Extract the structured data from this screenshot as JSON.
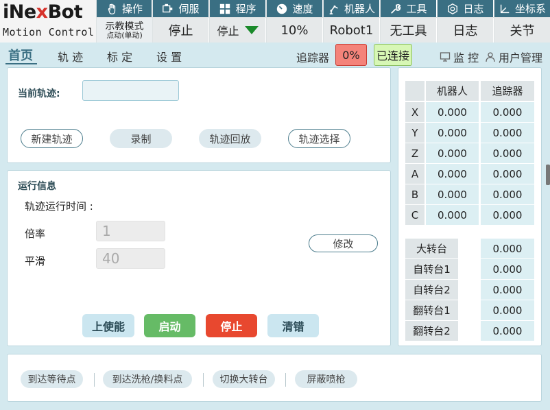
{
  "logo": {
    "brand_prefix": "iNe",
    "brand_x": "x",
    "brand_suffix": "Bot",
    "subtitle": "Motion Control"
  },
  "menu": [
    {
      "label": "操作",
      "icon": "hand-icon"
    },
    {
      "label": "伺服",
      "icon": "servo-icon"
    },
    {
      "label": "程序",
      "icon": "program-grid-icon"
    },
    {
      "label": "速度",
      "icon": "speed-gauge-icon"
    },
    {
      "label": "机器人",
      "icon": "robot-arm-icon"
    },
    {
      "label": "工具",
      "icon": "wrench-icon"
    },
    {
      "label": "日志",
      "icon": "log-icon"
    },
    {
      "label": "坐标系",
      "icon": "coordinate-icon"
    }
  ],
  "status": {
    "mode_line1": "示教模式",
    "mode_line2": "点动(单动)",
    "servo": "停止",
    "program": "停止",
    "speed": "10%",
    "robot": "Robot1",
    "tool": "无工具",
    "log": "日志",
    "coord": "关节"
  },
  "nav": {
    "tabs": [
      "首页",
      "轨 迹",
      "标 定",
      "设 置"
    ],
    "tracker_label": "追踪器",
    "tracker_percent": "0%",
    "connection": "已连接",
    "monitor": "监 控",
    "user_mgmt": "用户管理"
  },
  "trajectory": {
    "current_label": "当前轨迹:",
    "current_value": "",
    "buttons": [
      "新建轨迹",
      "录制",
      "轨迹回放",
      "轨迹选择"
    ]
  },
  "run_info": {
    "title": "运行信息",
    "time_label": "轨迹运行时间 :",
    "ratio_label": "倍率",
    "ratio_value": "1",
    "smooth_label": "平滑",
    "smooth_value": "40",
    "modify_button": "修改",
    "enable_button": "上使能",
    "start_button": "启动",
    "stop_button": "停止",
    "clear_button": "清错"
  },
  "coords": {
    "headers": [
      "机器人",
      "追踪器"
    ],
    "rows": [
      {
        "axis": "X",
        "robot": "0.000",
        "tracker": "0.000"
      },
      {
        "axis": "Y",
        "robot": "0.000",
        "tracker": "0.000"
      },
      {
        "axis": "Z",
        "robot": "0.000",
        "tracker": "0.000"
      },
      {
        "axis": "A",
        "robot": "0.000",
        "tracker": "0.000"
      },
      {
        "axis": "B",
        "robot": "0.000",
        "tracker": "0.000"
      },
      {
        "axis": "C",
        "robot": "0.000",
        "tracker": "0.000"
      }
    ],
    "tables": [
      {
        "name": "大转台",
        "value": "0.000"
      },
      {
        "name": "自转台1",
        "value": "0.000"
      },
      {
        "name": "自转台2",
        "value": "0.000"
      },
      {
        "name": "翻转台1",
        "value": "0.000"
      },
      {
        "name": "翻转台2",
        "value": "0.000"
      }
    ]
  },
  "quick_actions": [
    "到达等待点",
    "到达洗枪/换料点",
    "切换大转台",
    "屏蔽喷枪"
  ],
  "colors": {
    "menu_bg": "#3a6f83",
    "start_green": "#66bb66",
    "stop_red": "#e8482f",
    "tracker_red": "#f4837a",
    "connected_green": "#d7f7b5"
  }
}
